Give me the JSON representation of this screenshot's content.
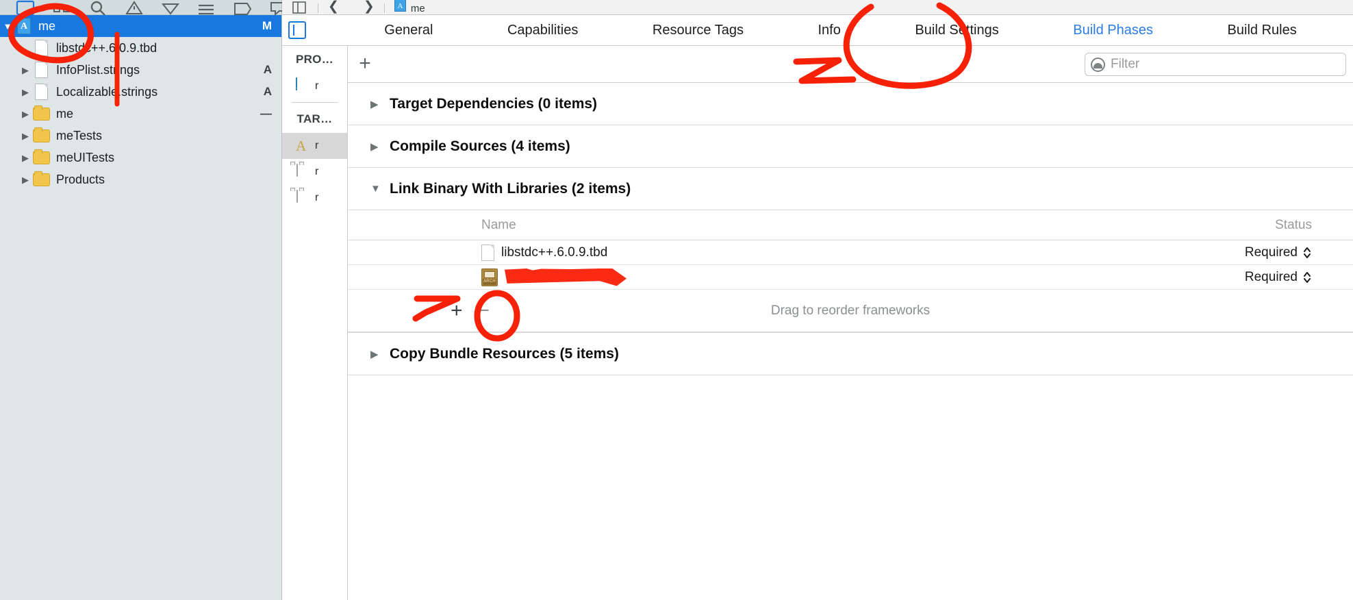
{
  "navigator": {
    "toolbar_icons": [
      {
        "name": "folder-icon",
        "selected": true
      },
      {
        "name": "source-control-icon",
        "selected": false
      },
      {
        "name": "search-icon",
        "selected": false
      },
      {
        "name": "issue-navigator-icon",
        "selected": false
      },
      {
        "name": "test-navigator-icon",
        "selected": false
      },
      {
        "name": "debug-navigator-icon",
        "selected": false
      },
      {
        "name": "breakpoint-navigator-icon",
        "selected": false
      },
      {
        "name": "report-navigator-icon",
        "selected": false
      }
    ],
    "rows": [
      {
        "twisty": "▼",
        "icon": "app-project-icon",
        "label": "me",
        "badge": "M",
        "selected": true,
        "indent": 0
      },
      {
        "twisty": "",
        "icon": "file-icon",
        "label": "libstdc++.6.0.9.tbd",
        "badge": "",
        "selected": false,
        "indent": 1
      },
      {
        "twisty": "▶",
        "icon": "file-icon",
        "label": "InfoPlist.strings",
        "badge": "A",
        "selected": false,
        "indent": 1
      },
      {
        "twisty": "▶",
        "icon": "file-icon",
        "label": "Localizable.strings",
        "badge": "A",
        "selected": false,
        "indent": 1
      },
      {
        "twisty": "▶",
        "icon": "folder-icon",
        "label": "me",
        "badge": "—",
        "selected": false,
        "indent": 1
      },
      {
        "twisty": "▶",
        "icon": "folder-icon",
        "label": "meTests",
        "badge": "",
        "selected": false,
        "indent": 1
      },
      {
        "twisty": "▶",
        "icon": "folder-icon",
        "label": "meUITests",
        "badge": "",
        "selected": false,
        "indent": 1
      },
      {
        "twisty": "▶",
        "icon": "folder-icon",
        "label": "Products",
        "badge": "",
        "selected": false,
        "indent": 1
      }
    ]
  },
  "editor_toolbar": {
    "related_items_icon": "related-items-icon",
    "back_arrow": "❮",
    "forward_arrow": "❯",
    "breadcrumb_label": "me",
    "breadcrumb_icon": "project-file-icon"
  },
  "tabbar": {
    "panel_toggle_icon": "navigator-toggle-icon",
    "tabs": [
      {
        "label": "General",
        "active": false
      },
      {
        "label": "Capabilities",
        "active": false
      },
      {
        "label": "Resource Tags",
        "active": false
      },
      {
        "label": "Info",
        "active": false
      },
      {
        "label": "Build Settings",
        "active": false
      },
      {
        "label": "Build Phases",
        "active": true
      },
      {
        "label": "Build Rules",
        "active": false
      }
    ]
  },
  "project_sidebar": {
    "project_header": "PRO…",
    "project_items": [
      {
        "label": "r",
        "icon": "project-icon",
        "selected": false
      }
    ],
    "targets_header": "TAR…",
    "target_items": [
      {
        "label": "r",
        "icon": "app-target-icon",
        "selected": true
      },
      {
        "label": "r",
        "icon": "test-bundle-icon",
        "selected": false
      },
      {
        "label": "r",
        "icon": "test-bundle-icon",
        "selected": false
      }
    ]
  },
  "phase_toolbar": {
    "add_label": "+",
    "add_icon": "plus-icon",
    "filter_icon": "filter-icon",
    "filter_placeholder": "Filter",
    "filter_value": ""
  },
  "phases": [
    {
      "twisty": "▶",
      "title": "Target Dependencies (0 items)",
      "expanded": false
    },
    {
      "twisty": "▶",
      "title": "Compile Sources (4 items)",
      "expanded": false
    },
    {
      "twisty": "▼",
      "title": "Link Binary With Libraries (2 items)",
      "expanded": true
    },
    {
      "twisty": "▶",
      "title": "Copy Bundle Resources (5 items)",
      "expanded": false
    }
  ],
  "link_binary": {
    "columns": {
      "name": "Name",
      "status": "Status"
    },
    "rows": [
      {
        "icon": "file-icon",
        "name": "libstdc++.6.0.9.tbd",
        "redacted": false,
        "status": "Required",
        "stepper_icon": "stepper-icon"
      },
      {
        "icon": "archive-icon",
        "name": "",
        "redacted": true,
        "status": "Required",
        "stepper_icon": "stepper-icon"
      }
    ],
    "footer": {
      "add_icon": "plus-icon",
      "add_label": "+",
      "remove_icon": "minus-icon",
      "remove_label": "−",
      "hint": "Drag to reorder frameworks"
    }
  },
  "annotations": {
    "color": "#f72108",
    "marks": [
      "circle-around-project-me",
      "vertical-line-in-navigator",
      "circle-around-build-phases-tab",
      "arrow-to-filter-field",
      "redaction-over-library-name",
      "arrow-to-add-framework",
      "circle-around-add-framework"
    ]
  },
  "colors": {
    "selection_blue": "#1878e0",
    "tab_active_blue": "#2b7ce8",
    "navigator_bg": "#dfe6e7",
    "annotation_red": "#f72108"
  }
}
